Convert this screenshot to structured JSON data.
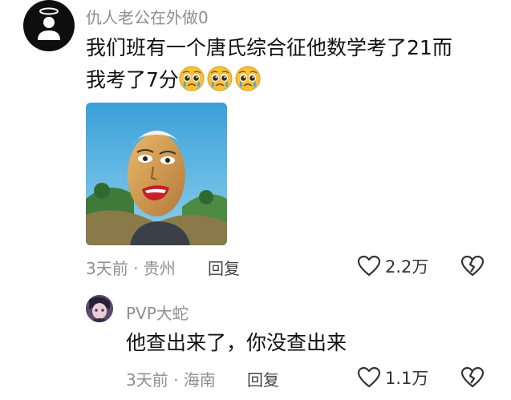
{
  "main_comment": {
    "username": "仇人老公在外做0",
    "text_line1": "我们班有一个唐氏综合征他数学考了21而",
    "text_line2": "我考了7分",
    "emoji_count": 3,
    "emoji_name": "pleading-face-emoji",
    "time_location": "3天前 · 贵州",
    "reply_label": "回复",
    "like_count": "2.2万"
  },
  "reply_comment": {
    "username": "PVP大蛇",
    "text": "他查出来了，你没查出来",
    "time_location": "3天前 · 海南",
    "reply_label": "回复",
    "like_count": "1.1万"
  },
  "icons": {
    "like": "heart-outline-icon",
    "dislike": "broken-heart-icon"
  },
  "colors": {
    "meta_gray": "#8e8e93",
    "text": "#111111"
  }
}
